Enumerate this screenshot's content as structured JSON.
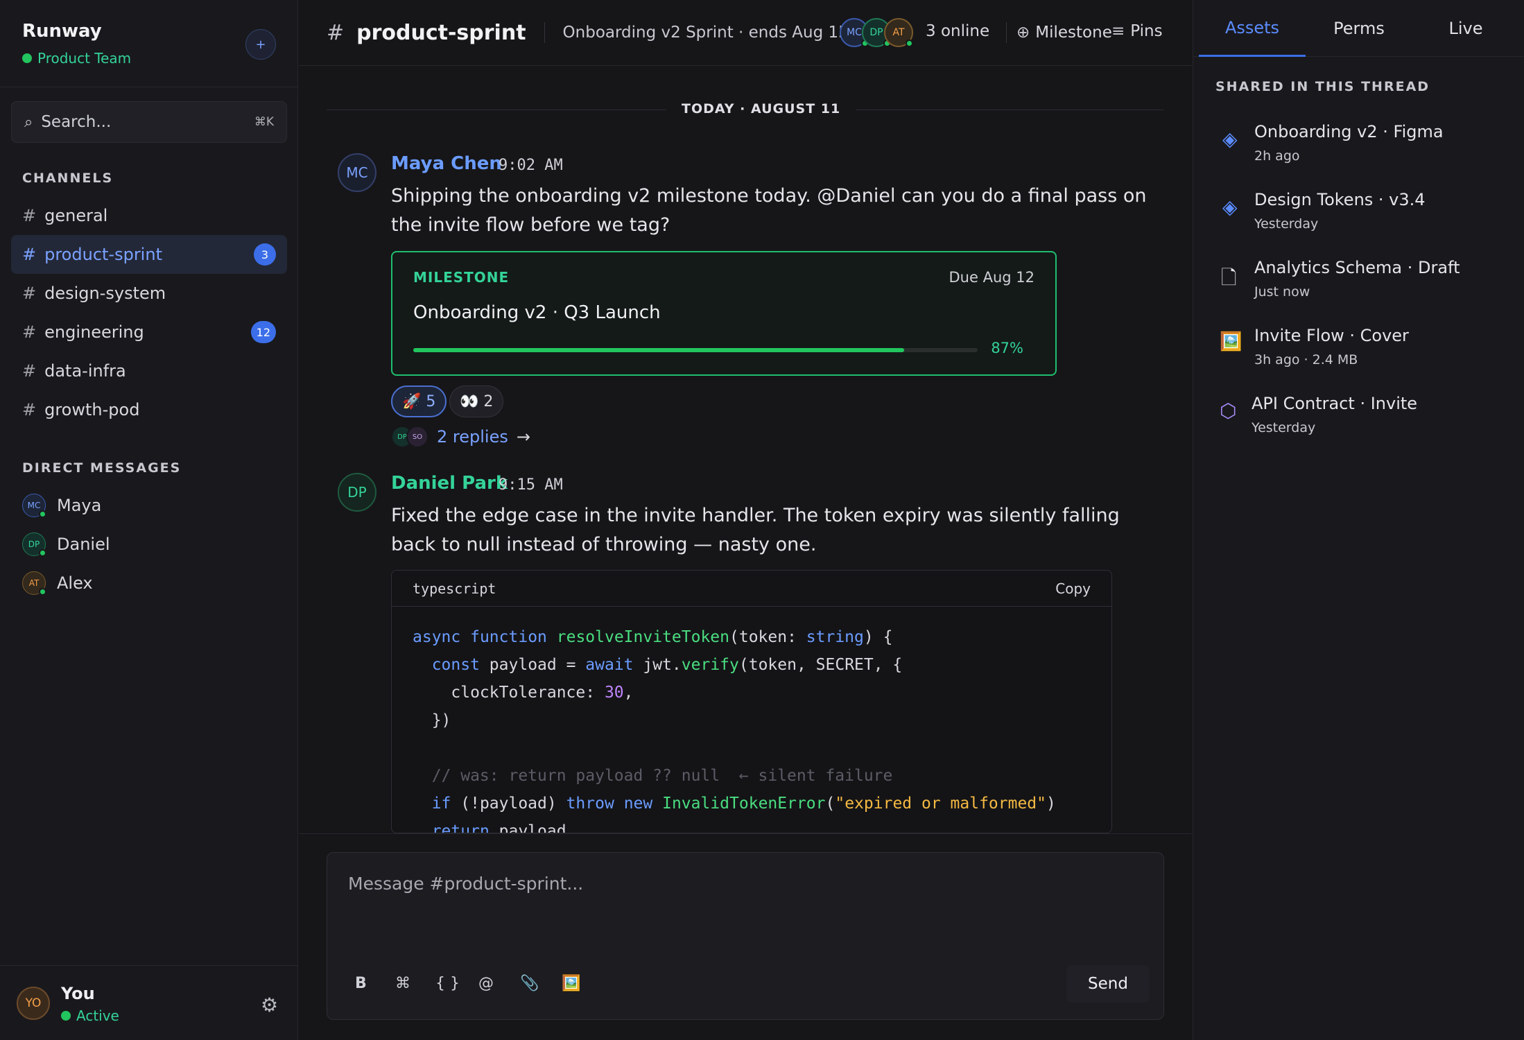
{
  "workspace": {
    "name": "Runway",
    "team": "Product Team",
    "add_label": "+"
  },
  "search": {
    "placeholder": "Search...",
    "shortcut": "⌘K"
  },
  "sidebar": {
    "channels_label": "CHANNELS",
    "channels": [
      {
        "name": "general",
        "badge": ""
      },
      {
        "name": "product-sprint",
        "badge": "3",
        "active": true
      },
      {
        "name": "design-system",
        "badge": ""
      },
      {
        "name": "engineering",
        "badge": "12"
      },
      {
        "name": "data-infra",
        "badge": ""
      },
      {
        "name": "growth-pod",
        "badge": ""
      }
    ],
    "dm_label": "DIRECT MESSAGES",
    "dms": [
      {
        "name": "Maya",
        "initials": "MC"
      },
      {
        "name": "Daniel",
        "initials": "DP"
      },
      {
        "name": "Alex",
        "initials": "AT"
      }
    ]
  },
  "user": {
    "initials": "YO",
    "name": "You",
    "status": "Active"
  },
  "header": {
    "hash": "#",
    "channel": "product-sprint",
    "subtitle": "Onboarding v2 Sprint · ends Aug 15",
    "avatars": [
      "MC",
      "DP",
      "AT"
    ],
    "online": "3 online",
    "milestone_label": "Milestone",
    "pins_label": "Pins"
  },
  "date_divider": "TODAY · AUGUST 11",
  "messages": [
    {
      "initials": "MC",
      "author": "Maya Chen",
      "time": "9:02 AM",
      "text": "Shipping the onboarding v2 milestone today. @Daniel can you do a final pass on the invite flow before we tag?",
      "milestone": {
        "label": "MILESTONE",
        "due": "Due Aug 12",
        "title": "Onboarding v2 · Q3 Launch",
        "progress": 0.87,
        "progress_label": "87%"
      },
      "reactions": [
        {
          "emoji": "🚀",
          "count": "5",
          "mine": true
        },
        {
          "emoji": "👀",
          "count": "2",
          "mine": false
        }
      ],
      "replies": {
        "avatars": [
          "DP",
          "SO"
        ],
        "label": "2 replies"
      }
    },
    {
      "initials": "DP",
      "author": "Daniel Park",
      "time": "9:15 AM",
      "text": "Fixed the edge case in the invite handler. The token expiry was silently falling back to null instead of throwing — nasty one.",
      "code": {
        "language": "typescript",
        "copy_label": "Copy",
        "lines": [
          "async function resolveInviteToken(token: string) {",
          "  const payload = await jwt.verify(token, SECRET, {",
          "    clockTolerance: 30,",
          "  })",
          "",
          "  // was: return payload ?? null  ← silent failure",
          "  if (!payload) throw new InvalidTokenError(\"expired or malformed\")",
          "  return payload"
        ]
      }
    }
  ],
  "composer": {
    "placeholder": "Message #product-sprint...",
    "tools": [
      "B",
      "⌘",
      "{ }",
      "@",
      "📎",
      "🖼️"
    ],
    "send_label": "Send"
  },
  "right_panel": {
    "tabs": [
      "Assets",
      "Perms",
      "Live"
    ],
    "shared_label": "SHARED IN THIS THREAD",
    "assets": [
      {
        "title": "Onboarding v2 · Figma",
        "meta": "2h ago",
        "icon": "figma-icon",
        "color": "#5b8cff"
      },
      {
        "title": "Design Tokens · v3.4",
        "meta": "Yesterday",
        "icon": "figma-icon",
        "color": "#5b8cff"
      },
      {
        "title": "Analytics Schema · Draft",
        "meta": "Just now",
        "icon": "document-icon",
        "color": "#e6e6ea"
      },
      {
        "title": "Invite Flow · Cover",
        "meta": "3h ago · 2.4 MB",
        "icon": "image-icon",
        "color": "#f5b942"
      },
      {
        "title": "API Contract · Invite",
        "meta": "Yesterday",
        "icon": "hexagon-icon",
        "color": "#a78bfa"
      }
    ]
  }
}
